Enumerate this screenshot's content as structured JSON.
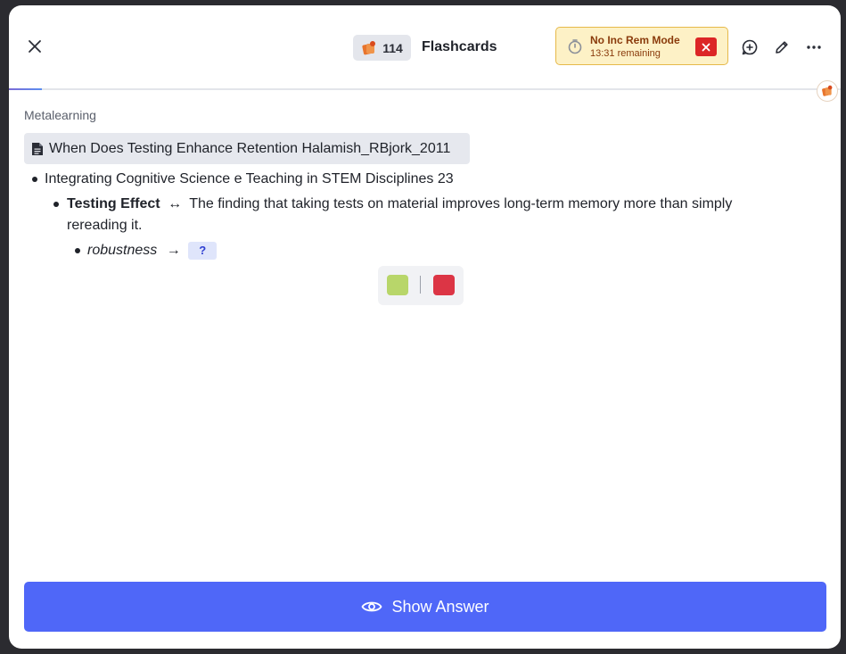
{
  "header": {
    "count": "114",
    "title": "Flashcards",
    "inc_mode": {
      "title": "No Inc Rem Mode",
      "remaining": "13:31 remaining"
    }
  },
  "progress": {
    "fraction": 0.04
  },
  "content": {
    "breadcrumb": "Metalearning",
    "document": "When Does Testing Enhance Retention Halamish_RBjork_2011",
    "item1": "Integrating Cognitive Science e Teaching in STEM Disciplines 23",
    "item2": {
      "term": "Testing Effect",
      "arrow": "↔",
      "definition": "The finding that taking tests on material improves long-term memory more than simply",
      "definition_cont": "rereading it."
    },
    "item3": {
      "term": "robustness",
      "arrow": "→",
      "cloze": "?"
    }
  },
  "colors": {
    "swatch_green": "#b8d66a",
    "swatch_red": "#dc3545",
    "accent": "#4f67f8"
  },
  "footer": {
    "show_answer": "Show Answer"
  }
}
